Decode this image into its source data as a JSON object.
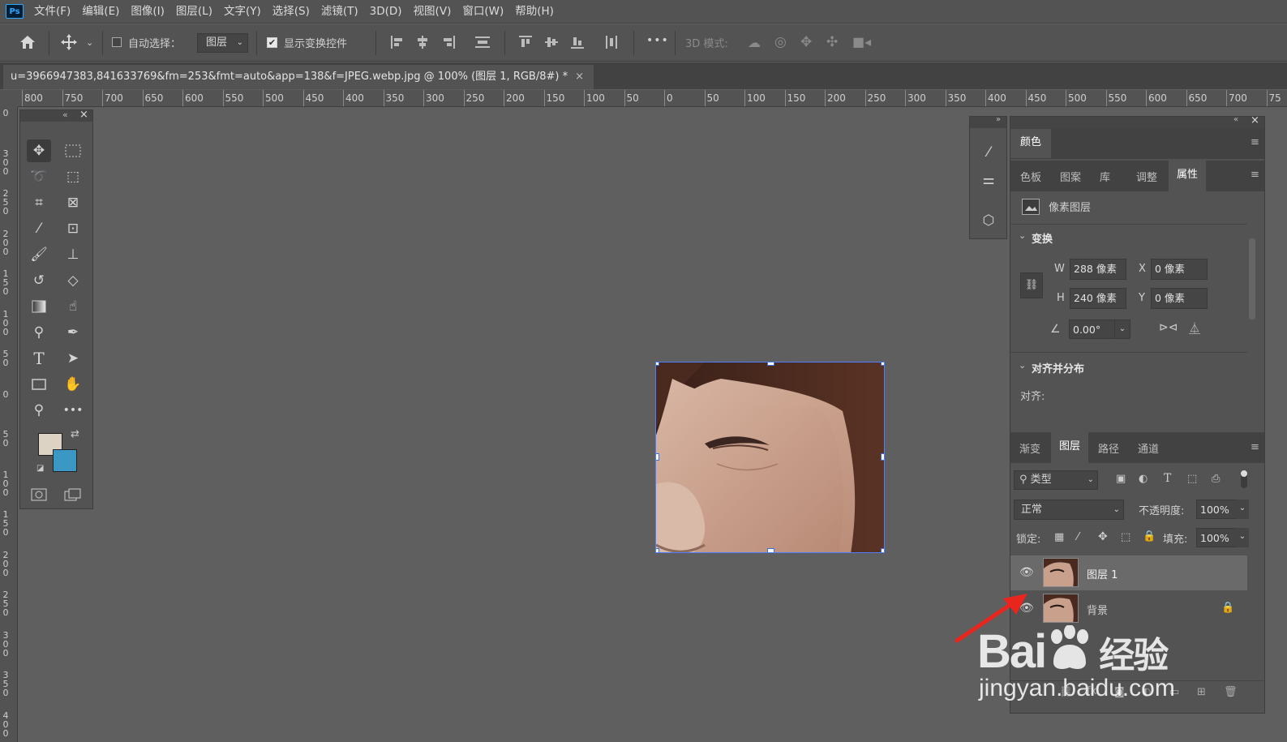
{
  "app": {
    "logo": "Ps"
  },
  "menu": [
    "文件(F)",
    "编辑(E)",
    "图像(I)",
    "图层(L)",
    "文字(Y)",
    "选择(S)",
    "滤镜(T)",
    "3D(D)",
    "视图(V)",
    "窗口(W)",
    "帮助(H)"
  ],
  "options": {
    "auto_select_label": "自动选择：",
    "auto_select_target": "图层",
    "show_transform_label": "显示变换控件",
    "mode_3d_label": "3D 模式:",
    "more": "•••"
  },
  "document_tab": {
    "title": "u=3966947383,841633769&fm=253&fmt=auto&app=138&f=JPEG.webp.jpg @ 100% (图层 1, RGB/8#) *",
    "close": "×"
  },
  "ruler_top": [
    "800",
    "750",
    "700",
    "650",
    "600",
    "550",
    "500",
    "450",
    "400",
    "350",
    "300",
    "250",
    "200",
    "150",
    "100",
    "50",
    "0",
    "50",
    "100",
    "150",
    "200",
    "250",
    "300",
    "350",
    "400",
    "450",
    "500",
    "550",
    "600",
    "650",
    "700",
    "75"
  ],
  "ruler_left": [
    "0",
    "3 0 0",
    "2 5 0",
    "2 0 0",
    "1 5 0",
    "1 0 0",
    "5 0",
    "0",
    "5 0",
    "1 0 0",
    "1 5 0",
    "2 0 0",
    "2 5 0",
    "3 0 0",
    "3 5 0",
    "4 0 0"
  ],
  "toolbox": {
    "collapse": "«",
    "close": "×"
  },
  "panels": {
    "color_tab": "颜色",
    "secondary_tabs": [
      "色板",
      "图案",
      "库",
      "调整",
      "属性"
    ],
    "active_secondary": "属性",
    "pixel_layer_label": "像素图层",
    "transform_header": "变换",
    "w_label": "W",
    "w_value": "288 像素",
    "x_label": "X",
    "x_value": "0 像素",
    "h_label": "H",
    "h_value": "240 像素",
    "y_label": "Y",
    "y_value": "0 像素",
    "angle_value": "0.00°",
    "align_header": "对齐并分布",
    "align_label": "对齐:",
    "layer_tabs": [
      "渐变",
      "图层",
      "路径",
      "通道"
    ],
    "active_layer_tab": "图层",
    "filter_kind": "类型",
    "blend_mode": "正常",
    "opacity_label": "不透明度:",
    "opacity_value": "100%",
    "lock_label": "锁定:",
    "fill_label": "填充:",
    "fill_value": "100%",
    "layers": [
      {
        "name": "图层 1",
        "visible": true,
        "selected": true
      },
      {
        "name": "背景",
        "visible": true,
        "selected": false,
        "locked": true
      }
    ]
  },
  "colors": {
    "foreground": "#dcd3c5",
    "background": "#3b98c4",
    "accent": "#31a8ff"
  },
  "watermark": {
    "brand": "Bai",
    "brand2": "du",
    "suffix": "经验",
    "url": "jingyan.baidu.com"
  }
}
